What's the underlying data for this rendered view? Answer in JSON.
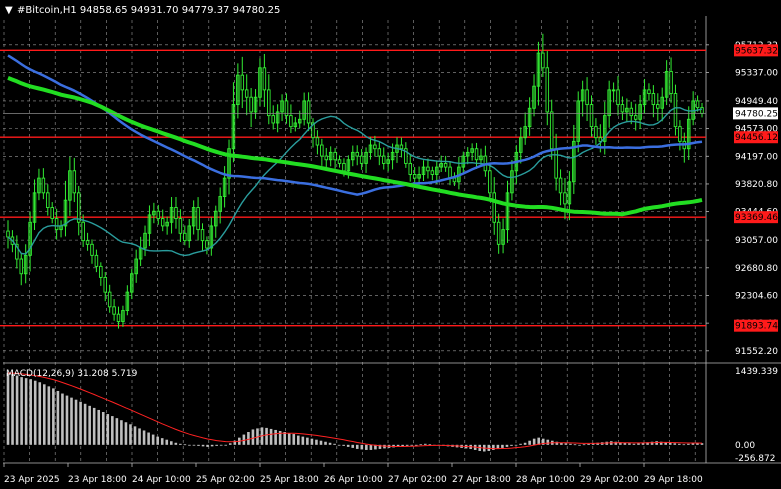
{
  "chart_data": {
    "type": "candlestick",
    "title": "#Bitcoin,H1  94858.65 94931.70 94779.37 94780.25",
    "symbol_marker": "▼",
    "price_axis": {
      "ylim": [
        91400,
        96050
      ],
      "ticks": [
        "95712.32",
        "95337.00",
        "94949.40",
        "94573.00",
        "94197.00",
        "93820.80",
        "93444.60",
        "93057.00",
        "92680.80",
        "92304.60",
        "91928.40",
        "91552.20"
      ]
    },
    "horizontal_levels": [
      {
        "value": 95637.32,
        "label": "95637.32",
        "color": "#ff1a1a"
      },
      {
        "value": 94456.12,
        "label": "94456.12",
        "color": "#ff1a1a"
      },
      {
        "value": 93369.46,
        "label": "93369.46",
        "color": "#ff1a1a"
      },
      {
        "value": 91893.74,
        "label": "91893.74",
        "color": "#ff1a1a"
      }
    ],
    "current_price": {
      "value": 94780.25,
      "label": "94780.25"
    },
    "time_axis": {
      "ticks": [
        "23 Apr 2025",
        "23 Apr 18:00",
        "24 Apr 10:00",
        "25 Apr 02:00",
        "25 Apr 18:00",
        "26 Apr 10:00",
        "27 Apr 02:00",
        "27 Apr 18:00",
        "28 Apr 10:00",
        "29 Apr 02:00",
        "29 Apr 18:00"
      ]
    },
    "close_series": [
      93100,
      93000,
      92800,
      92600,
      92850,
      93300,
      93700,
      93900,
      93700,
      93500,
      93350,
      93200,
      93250,
      93600,
      94000,
      93700,
      93300,
      93050,
      93000,
      92850,
      92700,
      92550,
      92350,
      92150,
      92050,
      91950,
      92100,
      92350,
      92600,
      92800,
      92950,
      93150,
      93400,
      93450,
      93350,
      93250,
      93300,
      93500,
      93350,
      93150,
      93050,
      93250,
      93500,
      93200,
      93050,
      92950,
      93250,
      93450,
      93650,
      93900,
      94300,
      94900,
      95300,
      95100,
      95000,
      94800,
      95000,
      95400,
      95100,
      94750,
      94650,
      94800,
      94950,
      94750,
      94600,
      94650,
      94700,
      94950,
      94650,
      94450,
      94350,
      94200,
      94150,
      94250,
      94150,
      94100,
      94000,
      94150,
      94250,
      94200,
      94100,
      94250,
      94350,
      94300,
      94200,
      94100,
      94150,
      94250,
      94350,
      94300,
      94100,
      93950,
      93900,
      93950,
      94050,
      94000,
      93950,
      94050,
      94100,
      94050,
      93900,
      93850,
      94050,
      94200,
      94250,
      94300,
      94150,
      94200,
      94000,
      93700,
      93300,
      93000,
      93200,
      93700,
      94000,
      94250,
      94450,
      94600,
      94850,
      95150,
      95600,
      95400,
      94800,
      94300,
      93900,
      93700,
      93550,
      93850,
      94400,
      94950,
      95100,
      94900,
      94600,
      94450,
      94400,
      94750,
      95100,
      95100,
      94900,
      94800,
      94850,
      94750,
      94700,
      94900,
      95100,
      95050,
      94900,
      94850,
      95000,
      95350,
      95050,
      94600,
      94400,
      94300,
      94700,
      94950,
      94858.65,
      94780.25
    ],
    "candle_ranges": [
      350,
      320,
      300,
      280,
      330,
      420,
      380,
      300,
      280,
      260,
      240,
      230,
      260,
      450,
      480,
      360,
      300,
      260,
      240,
      220,
      210,
      200,
      220,
      240,
      230,
      200,
      220,
      230,
      240,
      260,
      260,
      260,
      320,
      280,
      250,
      240,
      230,
      260,
      250,
      250,
      240,
      260,
      300,
      290,
      250,
      230,
      260,
      270,
      300,
      360,
      420,
      540,
      620,
      500,
      440,
      380,
      360,
      460,
      430,
      390,
      330,
      300,
      330,
      310,
      290,
      260,
      250,
      290,
      280,
      260,
      250,
      230,
      220,
      240,
      220,
      210,
      220,
      230,
      230,
      220,
      220,
      230,
      230,
      220,
      210,
      210,
      220,
      230,
      240,
      220,
      220,
      220,
      210,
      210,
      220,
      210,
      210,
      220,
      220,
      210,
      220,
      220,
      240,
      230,
      230,
      220,
      220,
      220,
      260,
      300,
      380,
      420,
      360,
      420,
      400,
      360,
      340,
      340,
      380,
      420,
      520,
      480,
      520,
      450,
      400,
      360,
      360,
      380,
      420,
      460,
      420,
      380,
      360,
      320,
      320,
      360,
      360,
      340,
      320,
      300,
      300,
      300,
      300,
      300,
      320,
      320,
      300,
      300,
      320,
      380,
      340,
      360,
      330,
      320,
      330,
      300,
      180,
      152
    ],
    "moving_averages": [
      {
        "color": "#2a9d9d",
        "width": 1.4,
        "values": []
      },
      {
        "color": "#3b6fe0",
        "width": 2.5,
        "values": []
      },
      {
        "color": "#22dd22",
        "width": 4,
        "values": []
      }
    ],
    "indicator": {
      "name": "MACD(12,26,9) 31.208 5.719",
      "ylim": [
        -256.872,
        1439.339
      ],
      "ticks": [
        "1439.339",
        "0.00",
        "-256.872"
      ],
      "histogram_color": "#bfbfbf",
      "signal_color": "#ff2222",
      "histogram": [
        1400,
        1380,
        1350,
        1320,
        1300,
        1280,
        1250,
        1220,
        1180,
        1140,
        1100,
        1050,
        1000,
        960,
        920,
        880,
        840,
        800,
        760,
        720,
        680,
        640,
        600,
        560,
        520,
        480,
        440,
        400,
        360,
        320,
        280,
        240,
        200,
        160,
        130,
        100,
        70,
        40,
        20,
        10,
        0,
        -10,
        -20,
        -30,
        -40,
        -30,
        -20,
        -10,
        0,
        30,
        80,
        140,
        200,
        250,
        300,
        320,
        340,
        330,
        310,
        290,
        270,
        250,
        230,
        210,
        180,
        160,
        140,
        120,
        100,
        80,
        60,
        40,
        20,
        0,
        -20,
        -40,
        -60,
        -80,
        -90,
        -100,
        -100,
        -90,
        -80,
        -70,
        -60,
        -50,
        -40,
        -30,
        -20,
        -10,
        0,
        10,
        20,
        10,
        0,
        -10,
        -20,
        -30,
        -40,
        -50,
        -60,
        -70,
        -80,
        -100,
        -120,
        -130,
        -120,
        -100,
        -80,
        -60,
        -40,
        -20,
        0,
        20,
        40,
        80,
        120,
        140,
        120,
        100,
        80,
        60,
        40,
        30,
        20,
        10,
        0,
        10,
        20,
        30,
        40,
        50,
        60,
        70,
        60,
        50,
        40,
        30,
        20,
        30,
        40,
        50,
        60,
        70,
        60,
        50,
        40,
        30,
        20,
        10,
        20,
        31,
        31,
        31
      ],
      "signal": []
    }
  }
}
